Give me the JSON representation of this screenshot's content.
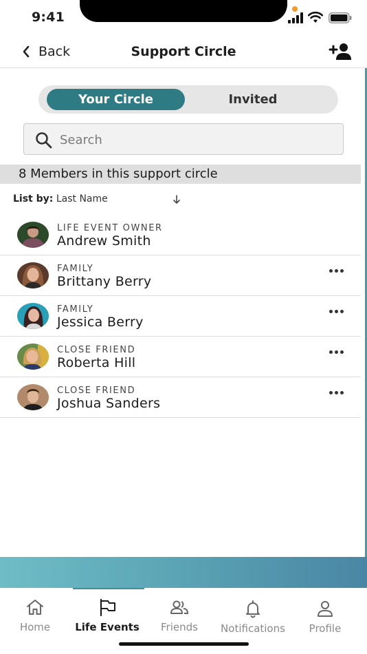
{
  "status_bar": {
    "time": "9:41"
  },
  "header": {
    "back_label": "Back",
    "title": "Support Circle"
  },
  "segment": {
    "active_label": "Your Circle",
    "inactive_label": "Invited"
  },
  "search": {
    "placeholder": "Search",
    "value": ""
  },
  "members_banner": "8 Members in this support circle",
  "list_by": {
    "label": "List by:",
    "field": "Last Name"
  },
  "members": [
    {
      "role": "LIFE EVENT OWNER",
      "name": "Andrew Smith",
      "has_menu": false,
      "avatar_colors": [
        "#7a4e5e",
        "#2c4a2a"
      ]
    },
    {
      "role": "FAMILY",
      "name": "Brittany Berry",
      "has_menu": true,
      "avatar_colors": [
        "#b87a5a",
        "#5a3a2a"
      ]
    },
    {
      "role": "FAMILY",
      "name": "Jessica Berry",
      "has_menu": true,
      "avatar_colors": [
        "#2aa0b8",
        "#4a2a2a"
      ]
    },
    {
      "role": "CLOSE FRIEND",
      "name": "Roberta Hill",
      "has_menu": true,
      "avatar_colors": [
        "#c8a05a",
        "#6a8a4a"
      ]
    },
    {
      "role": "CLOSE FRIEND",
      "name": "Joshua Sanders",
      "has_menu": true,
      "avatar_colors": [
        "#b08a6a",
        "#3a2a1a"
      ]
    }
  ],
  "tabs": [
    {
      "label": "Home",
      "icon": "home-icon",
      "active": false
    },
    {
      "label": "Life Events",
      "icon": "flag-icon",
      "active": true
    },
    {
      "label": "Friends",
      "icon": "friends-icon",
      "active": false
    },
    {
      "label": "Notifications",
      "icon": "bell-icon",
      "active": false
    },
    {
      "label": "Profile",
      "icon": "person-icon",
      "active": false
    }
  ],
  "colors": {
    "accent": "#2f7b84",
    "status_dot": "#f29a2e",
    "gradient_start": "#6fbcc6",
    "gradient_end": "#4a86a3"
  }
}
